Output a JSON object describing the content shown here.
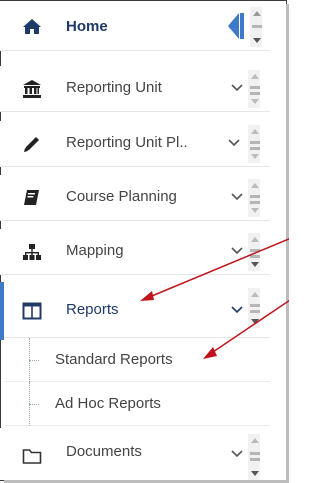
{
  "menu": {
    "items": [
      {
        "label": "Home",
        "icon": "home-icon"
      },
      {
        "label": "Reporting Unit",
        "icon": "institution-icon"
      },
      {
        "label": "Reporting Unit Pl..",
        "icon": "pencil-icon"
      },
      {
        "label": "Course Planning",
        "icon": "book-icon"
      },
      {
        "label": "Mapping",
        "icon": "sitemap-icon"
      },
      {
        "label": "Reports",
        "icon": "columns-icon"
      },
      {
        "label": "Documents",
        "icon": "folder-icon"
      }
    ],
    "submenu": [
      {
        "label": "Standard Reports"
      },
      {
        "label": "Ad Hoc Reports"
      }
    ]
  },
  "colors": {
    "accent": "#3f7ac7",
    "home": "#1f3a66",
    "annotation_arrow": "#c0141c"
  }
}
